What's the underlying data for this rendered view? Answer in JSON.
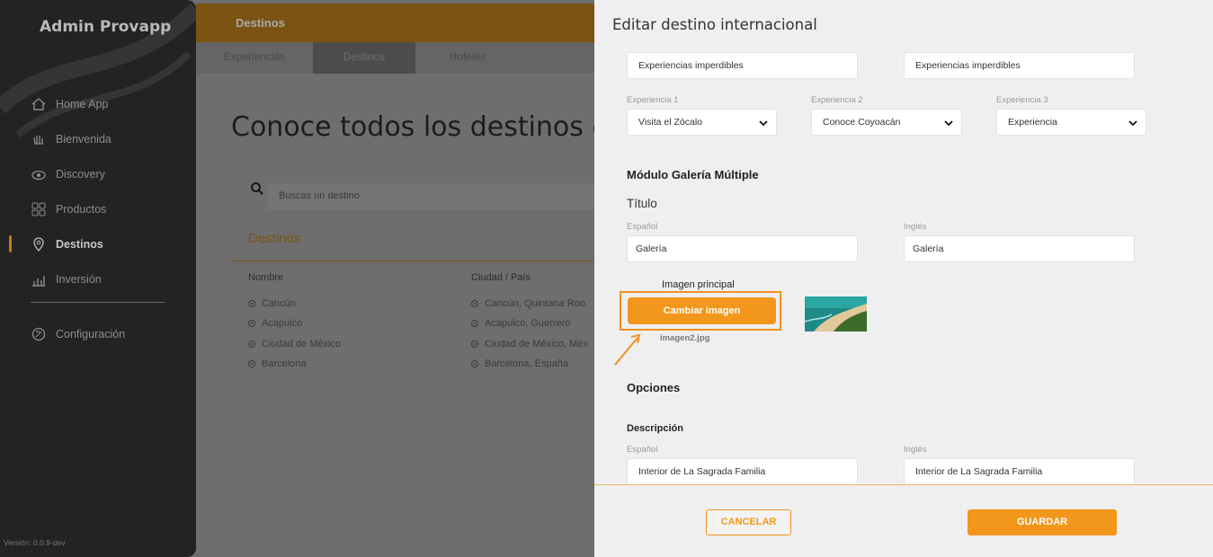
{
  "sidebar": {
    "brand": "Admin Provapp",
    "items": [
      {
        "label": "Home App",
        "icon": "home-icon"
      },
      {
        "label": "Bienvenida",
        "icon": "wave-hand-icon"
      },
      {
        "label": "Discovery",
        "icon": "eye-icon"
      },
      {
        "label": "Productos",
        "icon": "grid-icon"
      },
      {
        "label": "Destinos",
        "icon": "location-pin-icon",
        "active": true
      },
      {
        "label": "Inversión",
        "icon": "chart-icon"
      }
    ],
    "config_label": "Configuración",
    "version": "Versión: 0.0.9-dev"
  },
  "main": {
    "topbar_title": "Destinos",
    "tabs": [
      {
        "label": "Experiencias"
      },
      {
        "label": "Destinos",
        "active": true
      },
      {
        "label": "Hoteles"
      }
    ],
    "headline": "Conoce todos los destinos q",
    "search_placeholder": "Buscas un destino",
    "section_title": "Destinos",
    "columns": [
      "Nombre",
      "Ciudad / País"
    ],
    "rows": [
      {
        "name": "Cancún",
        "city": "Cancún, Quintana Roo"
      },
      {
        "name": "Acapulco",
        "city": "Acapulco, Guerrero"
      },
      {
        "name": "Ciudad de México",
        "city": "Ciudad de México, Méx"
      },
      {
        "name": "Barcelona",
        "city": "Barcelona, España"
      }
    ]
  },
  "modal": {
    "title": "Editar destino internacional",
    "top_inputs": {
      "es": "Experiencias imperdibles",
      "en": "Experiencias imperdibles"
    },
    "experiences": [
      {
        "label": "Experiencia 1",
        "value": "Visita el Zócalo"
      },
      {
        "label": "Experiencia 2",
        "value": "Conoce Coyoacán"
      },
      {
        "label": "Experiencia 3",
        "value": "Experiencia"
      }
    ],
    "gallery_title": "Módulo Galería Múltiple",
    "titulo_label": "Título",
    "lang_es": "Español",
    "lang_en": "Inglés",
    "gallery_es": "Galería",
    "gallery_en": "Galería",
    "image_label": "Imagen principal",
    "change_image_button": "Cambiar imagen",
    "filename": "imagen2.jpg",
    "options_title": "Opciones",
    "description_title": "Descripción",
    "desc_es": "Interior de La Sagrada Familia",
    "desc_en": "Interior de La Sagrada Familia",
    "cancel_button": "CANCELAR",
    "save_button": "GUARDAR"
  },
  "colors": {
    "accent": "#f2961c",
    "sidebar_bg": "#232323",
    "modal_bg": "#efefef"
  }
}
